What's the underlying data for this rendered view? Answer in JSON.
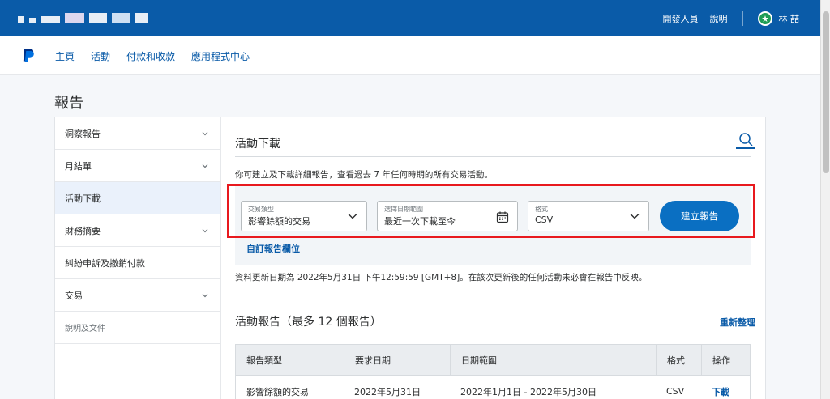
{
  "topbar": {
    "links": {
      "developer": "開發人員",
      "help": "說明"
    },
    "user_name": "林 喆"
  },
  "nav": {
    "items": [
      "主頁",
      "活動",
      "付款和收款",
      "應用程式中心"
    ]
  },
  "page": {
    "title": "報告"
  },
  "sidebar": {
    "items": [
      {
        "label": "洞察報告",
        "chevron": true
      },
      {
        "label": "月結單",
        "chevron": true
      },
      {
        "label": "活動下載",
        "chevron": false,
        "active": true
      },
      {
        "label": "財務摘要",
        "chevron": true
      },
      {
        "label": "糾紛申訴及撤銷付款",
        "chevron": false
      },
      {
        "label": "交易",
        "chevron": true
      },
      {
        "label": "說明及文件",
        "chevron": false,
        "small": true
      }
    ]
  },
  "activity": {
    "title": "活動下載",
    "description": "你可建立及下載詳細報告，查看過去 7 年任何時期的所有交易活動。",
    "filters": {
      "type_label": "交易類型",
      "type_value": "影響餘額的交易",
      "date_label": "選擇日期範圍",
      "date_value": "最近一次下載至今",
      "format_label": "格式",
      "format_value": "CSV"
    },
    "create_button": "建立報告",
    "custom_link": "自訂報告欄位",
    "update_note": "資料更新日期為 2022年5月31日 下午12:59:59 [GMT+8]。在該次更新後的任何活動未必會在報告中反映。"
  },
  "reports": {
    "title": "活動報告（最多 12 個報告）",
    "refresh": "重新整理",
    "headers": [
      "報告類型",
      "要求日期",
      "日期範圍",
      "格式",
      "操作"
    ],
    "rows": [
      {
        "type": "影響餘額的交易",
        "requested": "2022年5月31日",
        "range": "2022年1月1日 - 2022年5月30日",
        "format": "CSV",
        "action": "下載"
      }
    ]
  },
  "colors": {
    "brand": "#0a5ba8",
    "button": "#0a6fc2",
    "highlight": "#e8191e"
  }
}
